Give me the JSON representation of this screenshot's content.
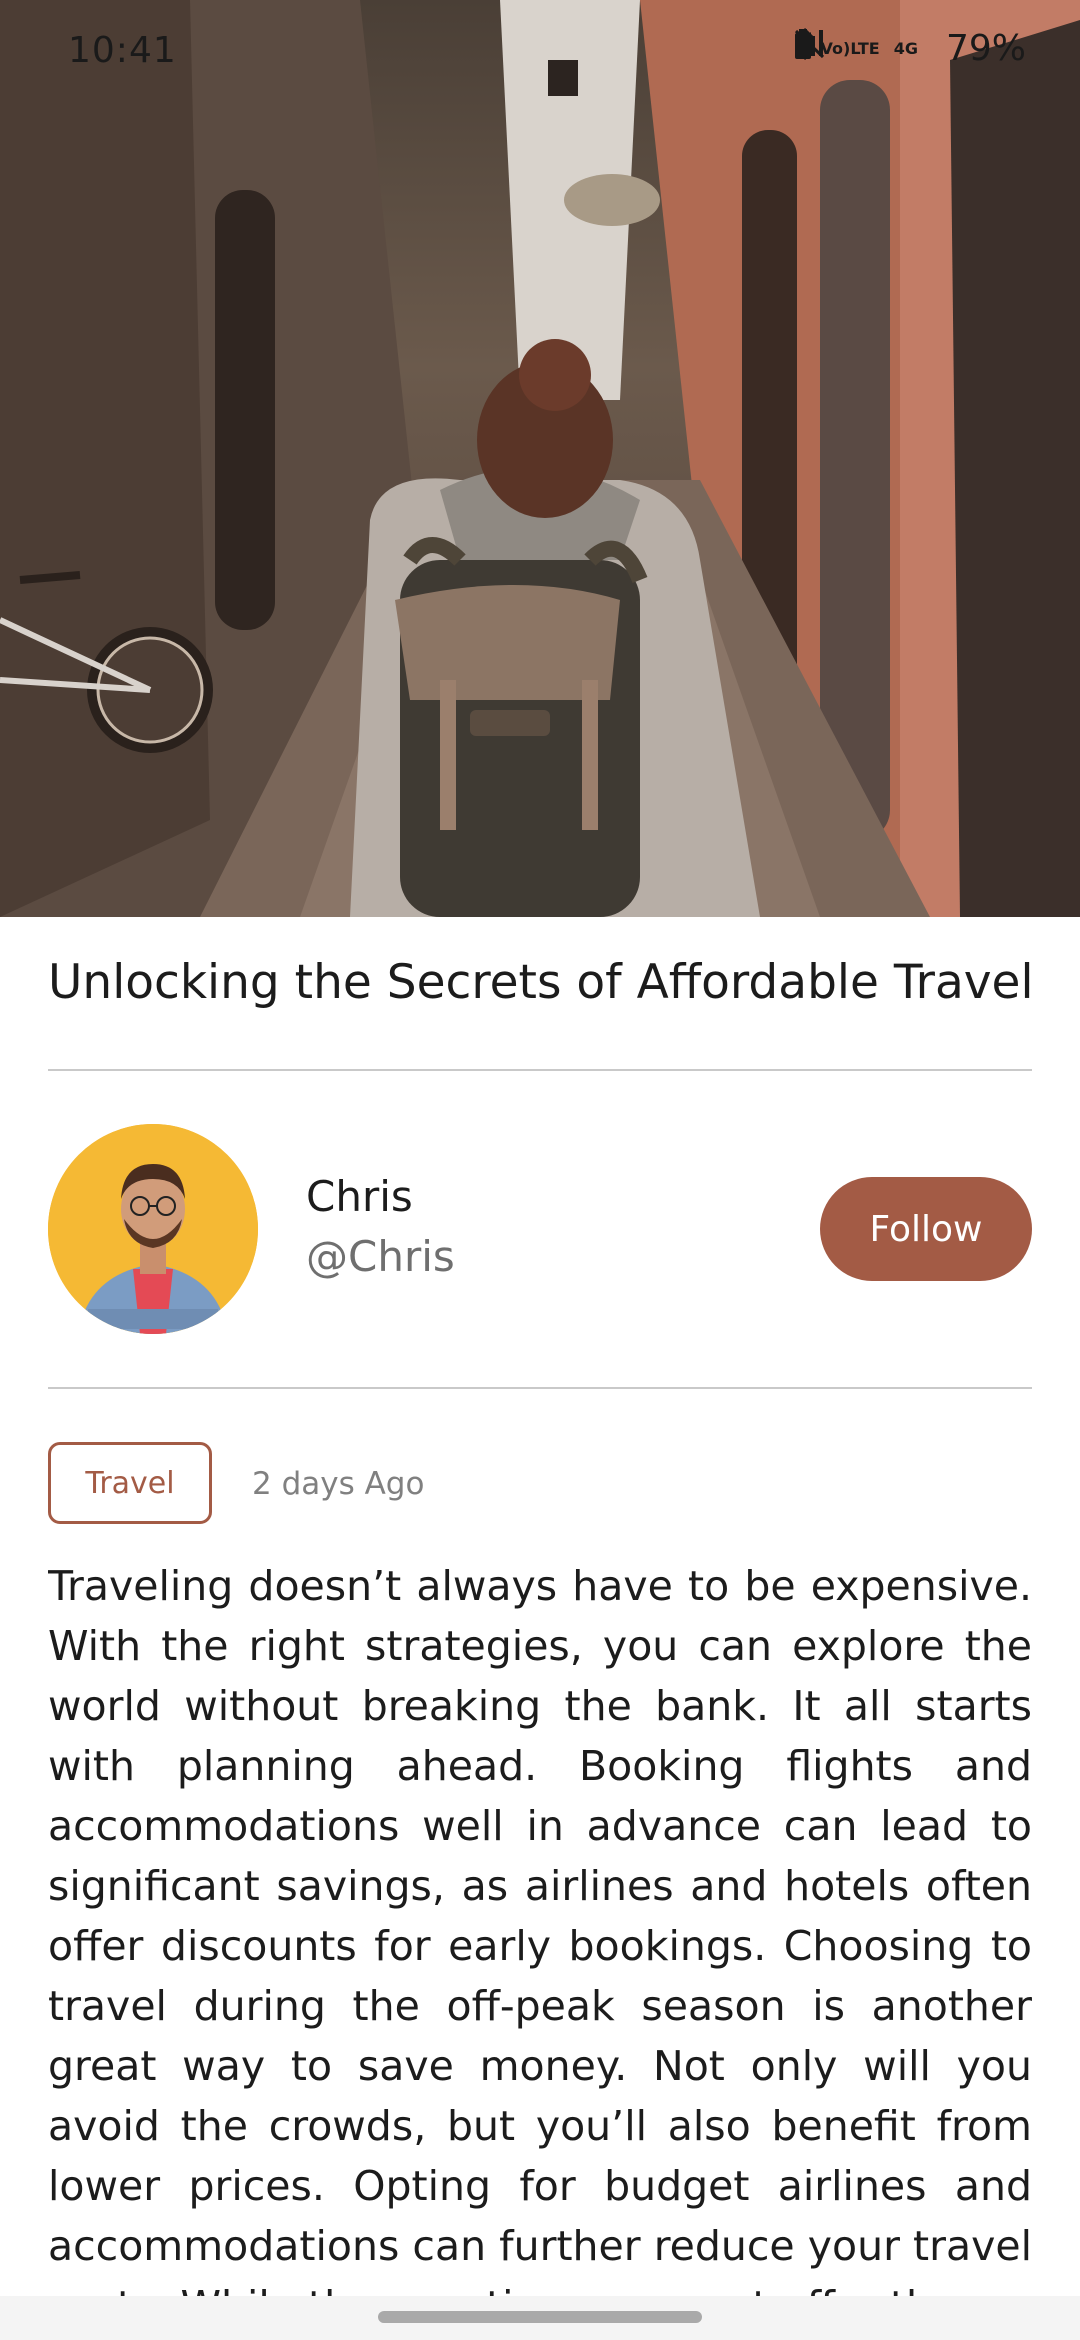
{
  "status_bar": {
    "time": "10:41",
    "network_top": "Vo)",
    "network_bottom": "LTE",
    "network_gen": "4G",
    "battery": "79%"
  },
  "hero": {
    "icon": "travel-photo"
  },
  "article": {
    "title": "Unlocking the Secrets of Affordable Travel",
    "category": "Travel",
    "posted": "2 days Ago",
    "body": "Traveling doesn’t always have to be expensive. With the right strategies, you can explore the world without breaking the bank. It all starts with planning ahead. Booking flights and accommodations well in advance can lead to significant savings, as airlines and hotels often offer discounts for early bookings. Choosing to travel during the off-peak season is another great way to save money. Not only will you avoid the crowds, but you’ll also benefit from lower prices. Opting for budget airlines and accommodations can further reduce your travel costs. While these options may not offer the"
  },
  "author": {
    "name": "Chris",
    "handle": "@Chris",
    "follow_label": "Follow"
  },
  "colors": {
    "accent": "#a35b45",
    "avatar_bg": "#f5b934",
    "divider": "#c9c9c9"
  }
}
